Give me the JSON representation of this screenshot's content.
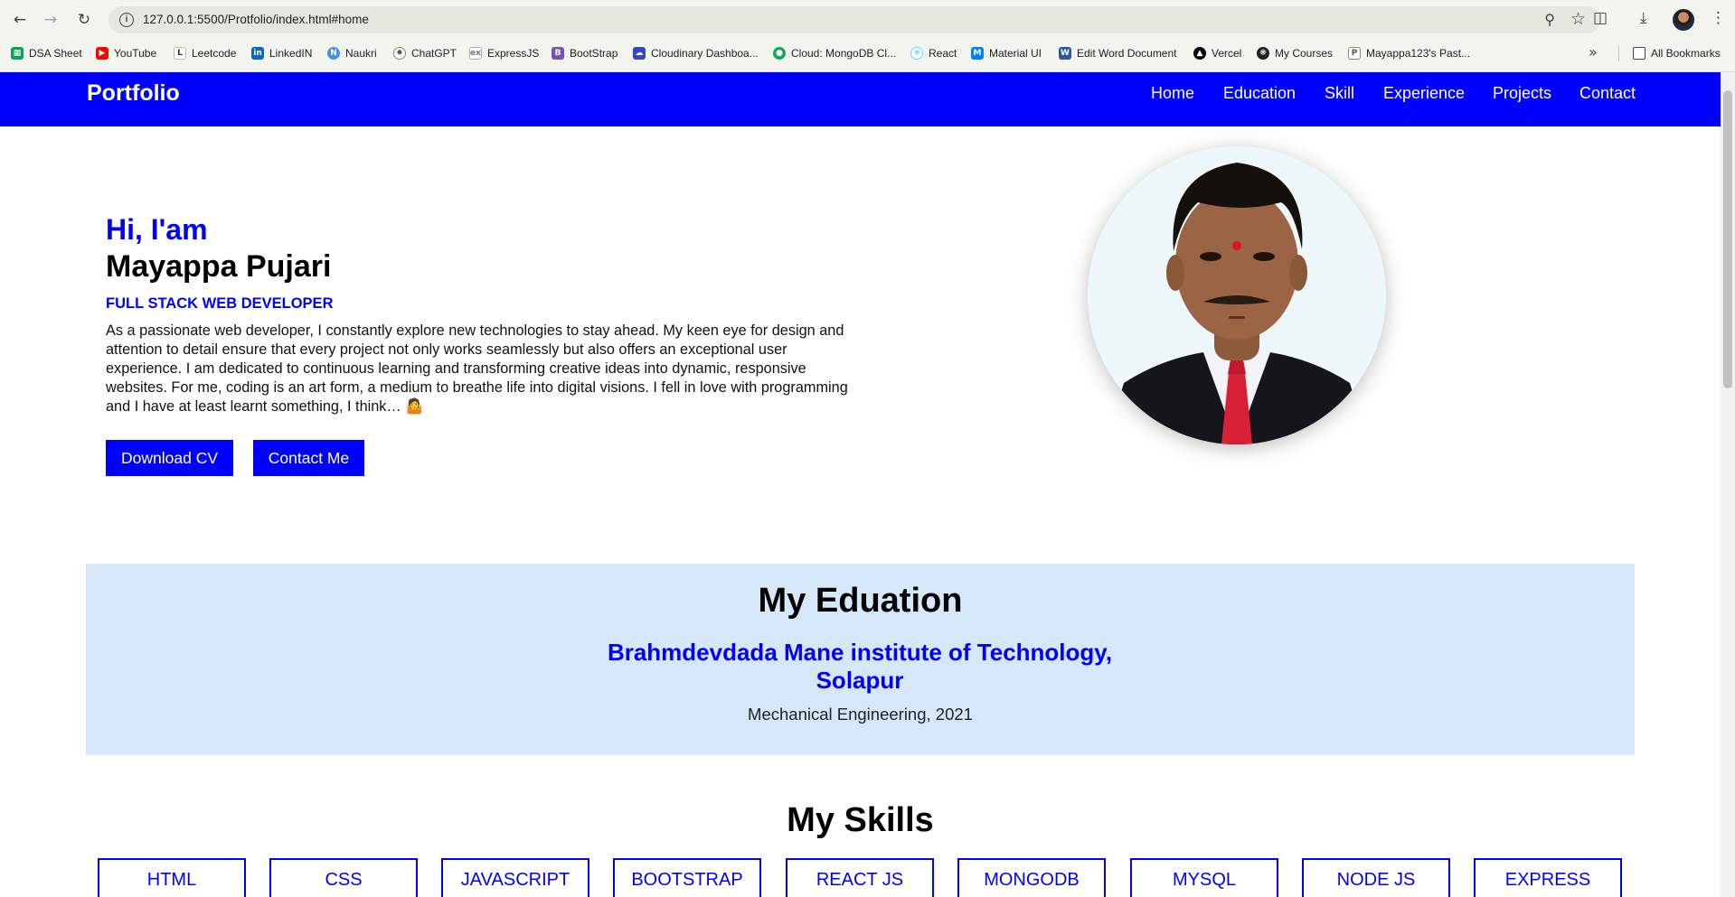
{
  "browser": {
    "url": "127.0.0.1:5500/Protfolio/index.html#home",
    "bookmarks": [
      {
        "label": "DSA Sheet",
        "icon": "sheet-icon",
        "color": "#0f9d58"
      },
      {
        "label": "YouTube",
        "icon": "youtube-icon",
        "color": "#ff0000"
      },
      {
        "label": "Leetcode",
        "icon": "leetcode-icon",
        "color": "#333333"
      },
      {
        "label": "LinkedIN",
        "icon": "linkedin-icon",
        "color": "#0a66c2"
      },
      {
        "label": "Naukri",
        "icon": "naukri-icon",
        "color": "#4a90e2"
      },
      {
        "label": "ChatGPT",
        "icon": "chatgpt-icon",
        "color": "#555555"
      },
      {
        "label": "ExpressJS",
        "icon": "express-icon",
        "color": "#888888"
      },
      {
        "label": "BootStrap",
        "icon": "bootstrap-icon",
        "color": "#7952b3"
      },
      {
        "label": "Cloudinary Dashboa...",
        "icon": "cloudinary-icon",
        "color": "#3448c5"
      },
      {
        "label": "Cloud: MongoDB Cl...",
        "icon": "mongodb-icon",
        "color": "#13aa52"
      },
      {
        "label": "React",
        "icon": "react-icon",
        "color": "#61dafb"
      },
      {
        "label": "Material UI",
        "icon": "mui-icon",
        "color": "#007fff"
      },
      {
        "label": "Edit Word Document",
        "icon": "word-icon",
        "color": "#2b579a"
      },
      {
        "label": "Vercel",
        "icon": "vercel-icon",
        "color": "#000000"
      },
      {
        "label": "My Courses",
        "icon": "courses-icon",
        "color": "#222222"
      },
      {
        "label": "Mayappa123's Past...",
        "icon": "pastebin-icon",
        "color": "#666666"
      }
    ],
    "all_bookmarks": "All Bookmarks"
  },
  "navbar": {
    "brand": "Portfolio",
    "links": [
      "Home",
      "Education",
      "Skill",
      "Experience",
      "Projects",
      "Contact"
    ],
    "color": "#0000ff"
  },
  "hero": {
    "greeting": "Hi, I'am",
    "name": "Mayappa Pujari",
    "role": "FULL STACK WEB DEVELOPER",
    "bio": "As a passionate web developer, I constantly explore new technologies to stay ahead. My keen eye for design and attention to detail ensure that every project not only works seamlessly but also offers an exceptional user experience. I am dedicated to continuous learning and transforming creative ideas into dynamic, responsive websites. For me, coding is an art form, a medium to breathe life into digital visions. I fell in love with programming and I have at least learnt something, I think… 🤷",
    "download_cv": "Download CV",
    "contact_me": "Contact Me"
  },
  "education": {
    "title": "My Eduation",
    "school": "Brahmdevdada Mane institute of Technology, Solapur",
    "degree": "Mechanical Engineering, 2021",
    "background": "#d5e7f8"
  },
  "skills": {
    "title": "My Skills",
    "items": [
      "HTML",
      "CSS",
      "JAVASCRIPT",
      "BOOTSTRAP",
      "REACT JS",
      "MONGODB",
      "MYSQL",
      "NODE JS",
      "EXPRESS"
    ]
  }
}
